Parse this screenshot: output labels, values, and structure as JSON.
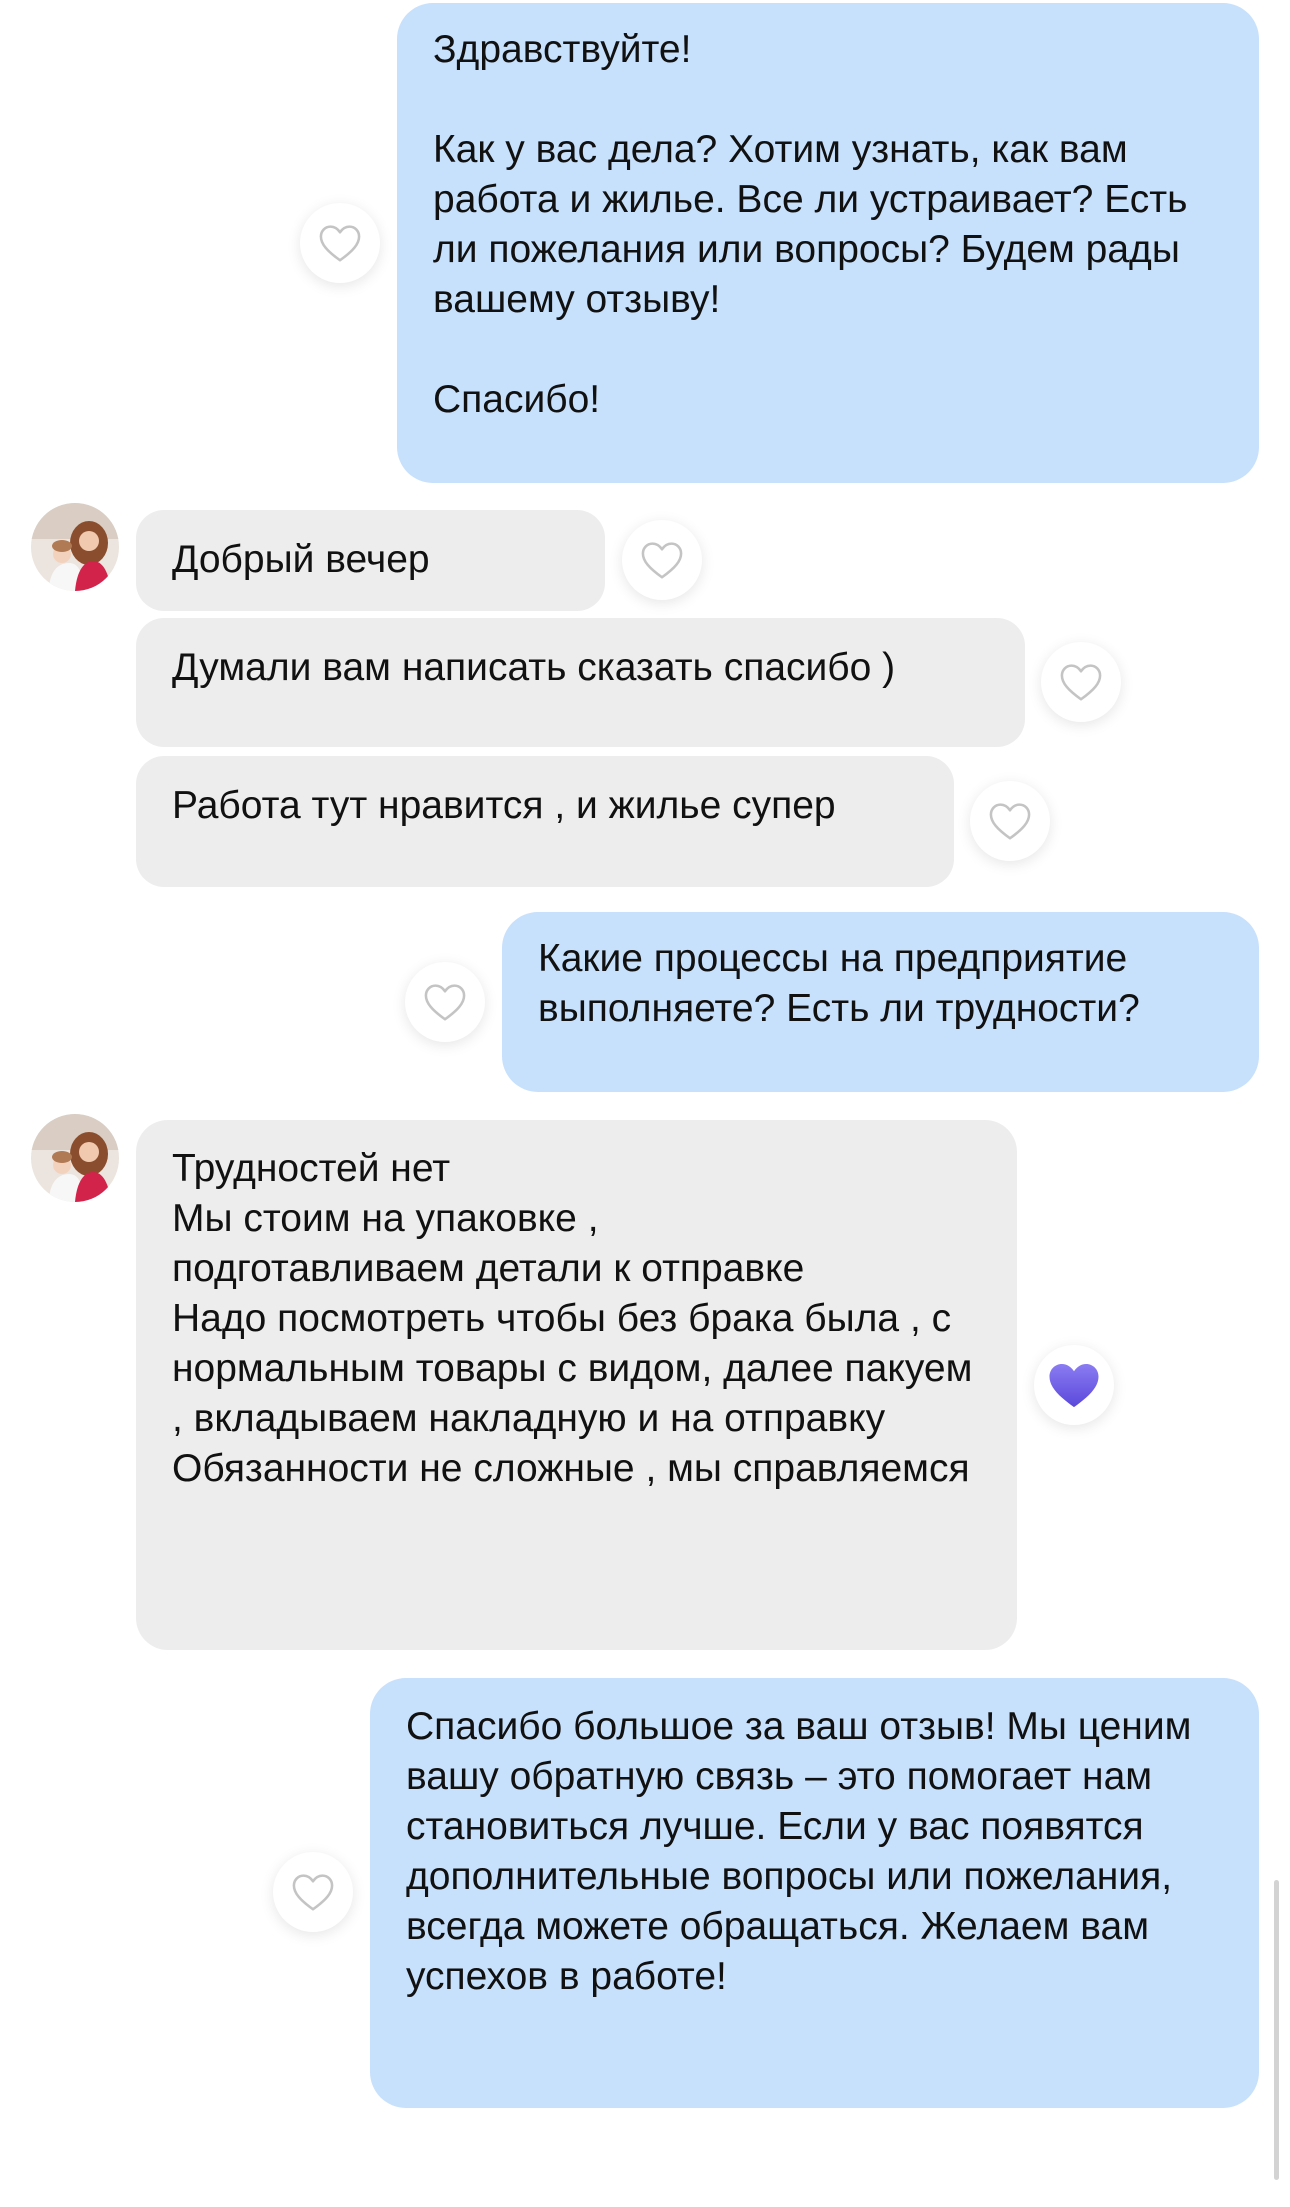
{
  "messages": [
    {
      "direction": "outgoing",
      "text": "Здравствуйте!\n\nКак у вас дела? Хотим узнать, как вам работа и жилье. Все ли устраивает? Есть ли пожелания или вопросы? Будем рады вашему отзыву!\n\nСпасибо!",
      "liked": false
    },
    {
      "direction": "incoming",
      "text": "Добрый вечер",
      "liked": false
    },
    {
      "direction": "incoming",
      "text": "Думали вам написать сказать спасибо )",
      "liked": false
    },
    {
      "direction": "incoming",
      "text": "Работа тут нравится , и жилье супер",
      "liked": false
    },
    {
      "direction": "outgoing",
      "text": "Какие процессы на предприятие выполняете? Есть ли трудности?",
      "liked": false
    },
    {
      "direction": "incoming",
      "text": "Трудностей нет\nМы стоим на упаковке ,\nподготавливаем детали к отправке\nНадо посмотреть чтобы без брака была , с нормальным товары с видом, далее пакуем , вкладываем накладную и на отправку\nОбязанности не сложные , мы справляемся",
      "liked": true
    },
    {
      "direction": "outgoing",
      "text": "Спасибо большое за ваш отзыв! Мы ценим вашу обратную связь – это помогает нам становиться лучше. Если у вас появятся дополнительные вопросы или пожелания, всегда можете обращаться. Желаем вам успехов в работе!",
      "liked": false
    }
  ],
  "icons": {
    "like": "heart-icon",
    "liked": "heart-filled-icon",
    "avatar": "avatar"
  },
  "colors": {
    "outgoing_bubble": "#c7e0fb",
    "incoming_bubble": "#ededed",
    "like_active": "#6e5ce6",
    "like_inactive": "#c4c4c4"
  }
}
